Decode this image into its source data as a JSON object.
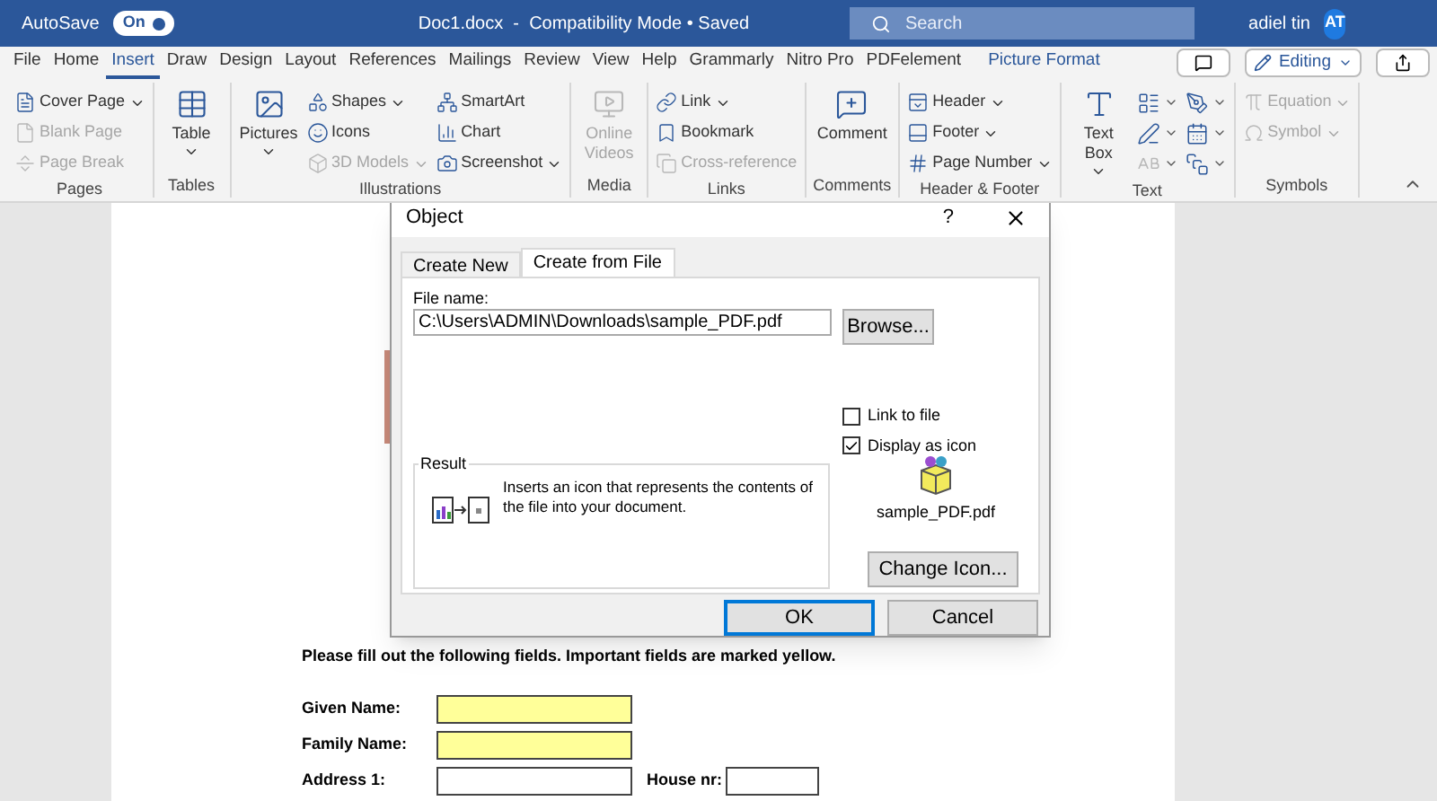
{
  "title_bar": {
    "autosave_label": "AutoSave",
    "autosave_toggle": {
      "label": "On",
      "on": true
    },
    "document_title": "Doc1.docx  -  Compatibility Mode • Saved",
    "search": {
      "placeholder": "Search"
    },
    "user_name": "adiel tin",
    "avatar": "AT"
  },
  "tabs": [
    {
      "label": "File",
      "selected": false,
      "kind": "normal"
    },
    {
      "label": "Home",
      "selected": false,
      "kind": "normal"
    },
    {
      "label": "Insert",
      "selected": true,
      "kind": "normal"
    },
    {
      "label": "Draw",
      "selected": false,
      "kind": "normal"
    },
    {
      "label": "Design",
      "selected": false,
      "kind": "normal"
    },
    {
      "label": "Layout",
      "selected": false,
      "kind": "normal"
    },
    {
      "label": "References",
      "selected": false,
      "kind": "normal"
    },
    {
      "label": "Mailings",
      "selected": false,
      "kind": "normal"
    },
    {
      "label": "Review",
      "selected": false,
      "kind": "normal"
    },
    {
      "label": "View",
      "selected": false,
      "kind": "normal"
    },
    {
      "label": "Help",
      "selected": false,
      "kind": "normal"
    },
    {
      "label": "Grammarly",
      "selected": false,
      "kind": "normal"
    },
    {
      "label": "Nitro Pro",
      "selected": false,
      "kind": "normal"
    },
    {
      "label": "PDFelement",
      "selected": false,
      "kind": "normal"
    },
    {
      "label": "Picture Format",
      "selected": false,
      "kind": "contextual"
    }
  ],
  "editing_button": "Editing",
  "ribbon_groups": [
    {
      "label": "Pages",
      "items": [
        {
          "kind": "small",
          "label": "Cover Page",
          "disabled": false,
          "dropdown": true
        },
        {
          "kind": "small",
          "label": "Blank Page",
          "disabled": true,
          "dropdown": false
        },
        {
          "kind": "small",
          "label": "Page Break",
          "disabled": true,
          "dropdown": false
        }
      ]
    },
    {
      "label": "Tables",
      "items": [
        {
          "kind": "large",
          "label": "Table",
          "disabled": false,
          "dropdown": true
        }
      ]
    },
    {
      "label": "Illustrations",
      "items": [
        {
          "kind": "large",
          "label": "Pictures",
          "disabled": false,
          "dropdown": true
        },
        {
          "kind": "small",
          "label": "Shapes",
          "disabled": false,
          "dropdown": true
        },
        {
          "kind": "small",
          "label": "Icons",
          "disabled": false,
          "dropdown": false
        },
        {
          "kind": "small",
          "label": "3D Models",
          "disabled": true,
          "dropdown": true
        },
        {
          "kind": "small",
          "label": "SmartArt",
          "disabled": false,
          "dropdown": false
        },
        {
          "kind": "small",
          "label": "Chart",
          "disabled": false,
          "dropdown": false
        },
        {
          "kind": "small",
          "label": "Screenshot",
          "disabled": false,
          "dropdown": true
        }
      ]
    },
    {
      "label": "Media",
      "items": [
        {
          "kind": "large",
          "label": "Online Videos",
          "disabled": true,
          "dropdown": false
        }
      ]
    },
    {
      "label": "Links",
      "items": [
        {
          "kind": "small",
          "label": "Link",
          "disabled": false,
          "dropdown": true
        },
        {
          "kind": "small",
          "label": "Bookmark",
          "disabled": false,
          "dropdown": false
        },
        {
          "kind": "small",
          "label": "Cross-reference",
          "disabled": true,
          "dropdown": false
        }
      ]
    },
    {
      "label": "Comments",
      "items": [
        {
          "kind": "large",
          "label": "Comment",
          "disabled": false,
          "dropdown": false
        }
      ]
    },
    {
      "label": "Header & Footer",
      "items": [
        {
          "kind": "small",
          "label": "Header",
          "disabled": false,
          "dropdown": true
        },
        {
          "kind": "small",
          "label": "Footer",
          "disabled": false,
          "dropdown": true
        },
        {
          "kind": "small",
          "label": "Page Number",
          "disabled": false,
          "dropdown": true
        }
      ]
    },
    {
      "label": "Text",
      "items": [
        {
          "kind": "large",
          "label": "Text Box",
          "disabled": false,
          "dropdown": true
        },
        {
          "kind": "tool",
          "disabled": false
        },
        {
          "kind": "tool",
          "disabled": false
        },
        {
          "kind": "tool",
          "disabled": true
        },
        {
          "kind": "tool",
          "disabled": false
        },
        {
          "kind": "tool",
          "disabled": false
        },
        {
          "kind": "tool",
          "disabled": false
        }
      ]
    },
    {
      "label": "Symbols",
      "items": [
        {
          "kind": "small",
          "label": "Equation",
          "disabled": true,
          "dropdown": true
        },
        {
          "kind": "small",
          "label": "Symbol",
          "disabled": true,
          "dropdown": true
        }
      ]
    }
  ],
  "document": {
    "intro": "Please fill out the following fields. Important fields are marked yellow.",
    "fields": [
      {
        "label": "Given Name:",
        "important": true
      },
      {
        "label": "Family Name:",
        "important": true
      },
      {
        "label": "Address 1:",
        "important": false,
        "extra_label": "House nr:"
      }
    ]
  },
  "dialog": {
    "title": "Object",
    "help": "?",
    "tabs": [
      {
        "label": "Create New",
        "selected": false
      },
      {
        "label": "Create from File",
        "selected": true
      }
    ],
    "file_name_label": "File name:",
    "file_name_value": "C:\\Users\\ADMIN\\Downloads\\sample_PDF.pdf",
    "browse": "Browse...",
    "options": [
      {
        "label": "Link to file",
        "checked": false
      },
      {
        "label": "Display as icon",
        "checked": true
      }
    ],
    "result_label": "Result",
    "result_text": "Inserts an icon that represents the contents of the file into your document.",
    "icon_caption": "sample_PDF.pdf",
    "change_icon": "Change Icon...",
    "ok": "OK",
    "cancel": "Cancel"
  }
}
